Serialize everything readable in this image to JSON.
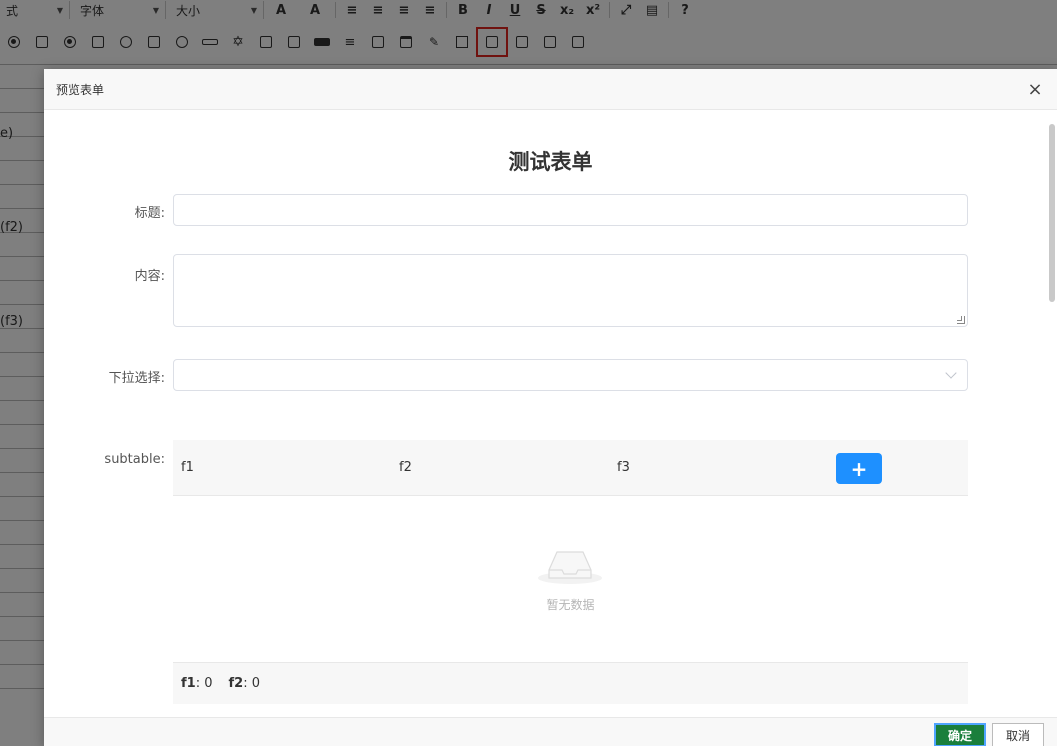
{
  "editor": {
    "toolbar": {
      "style_select": "式",
      "font_select": "字体",
      "size_select": "大小",
      "format_buttons": [
        "A",
        "A",
        "≡",
        "≡",
        "≡",
        "≡",
        "B",
        "I",
        "U",
        "S",
        "x₂",
        "x²",
        "⤢",
        "▤",
        "?"
      ]
    },
    "side_labels": [
      "e)",
      "(f2)",
      "(f3)"
    ]
  },
  "modal": {
    "title": "预览表单",
    "close_label": "×",
    "form_title": "测试表单",
    "fields": {
      "title_label": "标题:",
      "content_label": "内容:",
      "dropdown_label": "下拉选择:",
      "subtable_label": "subtable:"
    },
    "subtable": {
      "columns": [
        "f1",
        "f2",
        "f3"
      ],
      "add_label": "+",
      "empty_text": "暂无数据",
      "summary": [
        {
          "name": "f1",
          "sep": ":",
          "value": "0"
        },
        {
          "name": "f2",
          "sep": ":",
          "value": "0"
        }
      ]
    },
    "footer": {
      "ok_label": "确定",
      "cancel_label": "取消"
    }
  },
  "colors": {
    "accent": "#1e90ff",
    "ok_button": "#1a7f3c",
    "highlight_box": "#e0251f"
  }
}
